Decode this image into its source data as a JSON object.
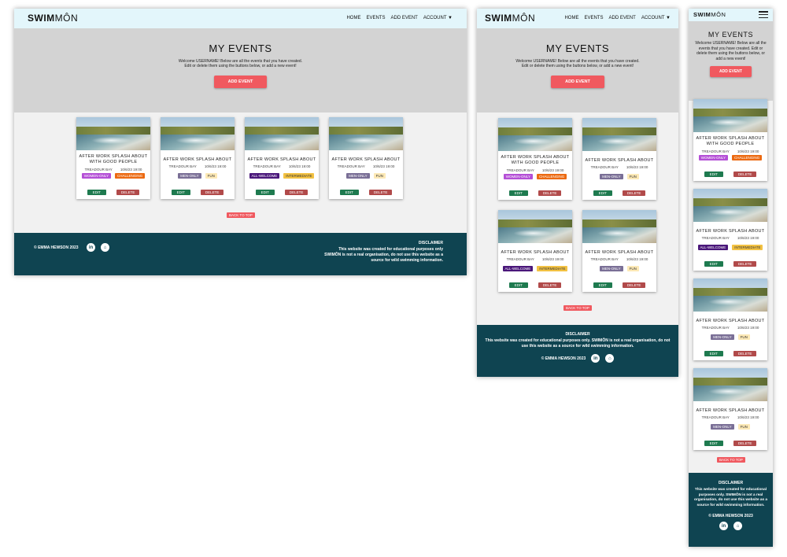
{
  "brand": {
    "logo_bold": "SWIM",
    "logo_light": "MÔN"
  },
  "nav": {
    "home": "HOME",
    "events": "EVENTS",
    "add_event": "ADD EVENT",
    "account": "ACCOUNT ▼"
  },
  "hero": {
    "title": "MY EVENTS",
    "line1": "Welcome USERNAME! Below are all the events that you have created.",
    "line2": "Edit or delete them using the buttons below, or add a new event!",
    "mobile_text": "Welcome USERNAME! Below are all the events that you have created. Edit or delete them using the buttons below, or add a new event!",
    "add_button": "ADD EVENT"
  },
  "events": [
    {
      "title": "AFTER WORK SPLASH ABOUT WITH GOOD PEOPLE",
      "location": "TREADOUR BAY",
      "datetime": "10/6/23 19:00",
      "tags": [
        "WOMEN-ONLY",
        "CHALLENGING"
      ]
    },
    {
      "title": "AFTER WORK SPLASH ABOUT",
      "location": "TREADOUR BAY",
      "datetime": "10/6/23 19:00",
      "tags": [
        "MEN-ONLY",
        "FUN"
      ]
    },
    {
      "title": "AFTER WORK SPLASH ABOUT",
      "location": "TREADOUR BAY",
      "datetime": "10/6/23 19:00",
      "tags": [
        "ALL-WELCOME",
        "INTERMEDIATE"
      ]
    },
    {
      "title": "AFTER WORK SPLASH ABOUT",
      "location": "TREADOUR BAY",
      "datetime": "10/6/23 19:00",
      "tags": [
        "MEN-ONLY",
        "FUN"
      ]
    }
  ],
  "card_buttons": {
    "edit": "EDIT",
    "delete": "DELETE"
  },
  "back_to_top": "BACK TO TOP",
  "footer": {
    "copyright": "© EMMA HEWSON 2023",
    "disclaimer_title": "DISCLAIMER",
    "disclaimer_desktop_1": "This website was created for educational purposes only",
    "disclaimer_desktop_2": "SWIMÔN is not a real organisation, do not use this website as a",
    "disclaimer_desktop_3": "source for wild swimming information.",
    "disclaimer_tablet_1": "This website was created for educational purposes only. SWIMÔN is not a real organisation, do not",
    "disclaimer_tablet_2": "use this website as a source for wild swimming information.",
    "disclaimer_mobile": "This website was created for educational purposes only. SWIMÔN is not a real organisation, do not use this website as a source for wild swimming information.",
    "linkedin": "in",
    "github": "⌂"
  },
  "colors": {
    "navbar": "#e3f6fb",
    "hero": "#d3d3d3",
    "accent": "#f0595f",
    "footer": "#0f4451",
    "edit": "#1e7a4f",
    "delete": "#b14a4a"
  }
}
